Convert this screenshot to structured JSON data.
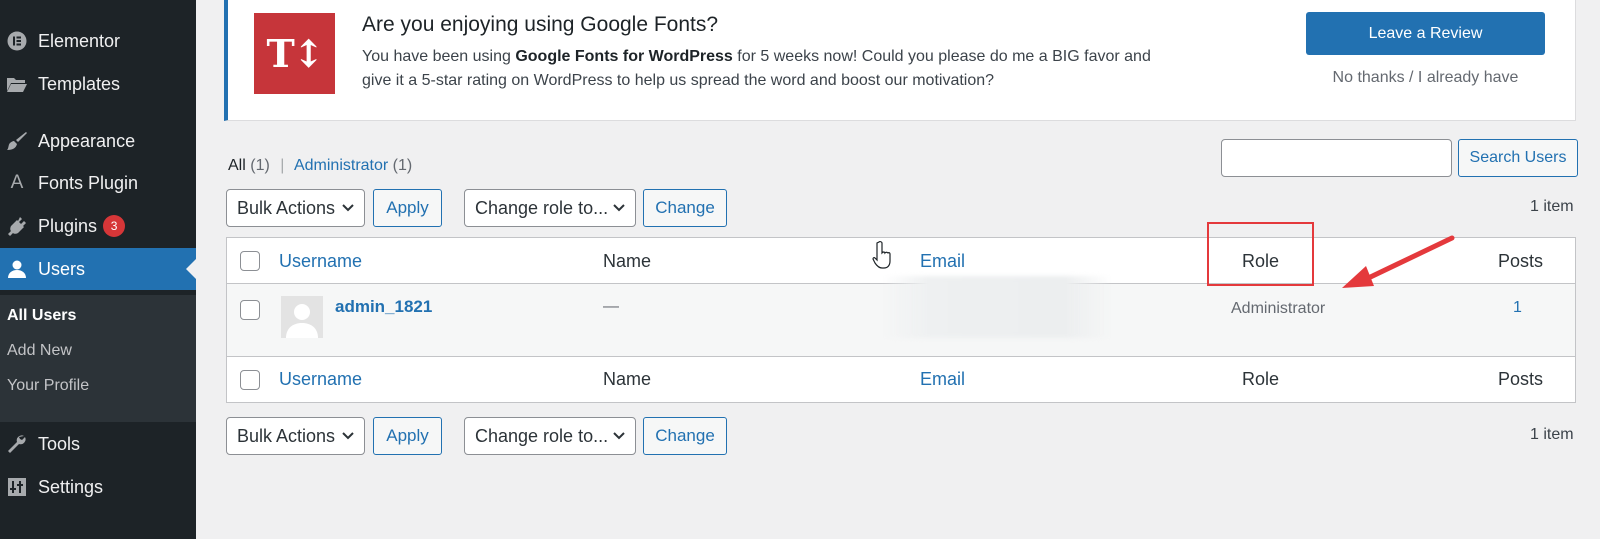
{
  "sidebar": {
    "items": [
      {
        "label": "Elementor",
        "icon": "elementor-icon"
      },
      {
        "label": "Templates",
        "icon": "folder-icon"
      },
      {
        "label": "Appearance",
        "icon": "paintbrush-icon"
      },
      {
        "label": "Fonts Plugin",
        "icon": "font-a-icon"
      },
      {
        "label": "Plugins",
        "icon": "plugin-icon",
        "badge": "3"
      },
      {
        "label": "Users",
        "icon": "user-icon",
        "active": true
      },
      {
        "label": "Tools",
        "icon": "wrench-icon"
      },
      {
        "label": "Settings",
        "icon": "settings-icon"
      }
    ],
    "submenu": [
      "All Users",
      "Add New",
      "Your Profile"
    ]
  },
  "notice": {
    "title": "Are you enjoying using Google Fonts?",
    "text_before": "You have been using ",
    "text_bold": "Google Fonts for WordPress",
    "text_after": " for 5 weeks now! Could you please do me a BIG favor and give it a 5-star rating on WordPress to help us spread the word and boost our motivation?",
    "review_button": "Leave a Review",
    "dismiss_link": "No thanks / I already have",
    "logo_text": "T↕"
  },
  "filters": {
    "all_label": "All",
    "all_count": "(1)",
    "admin_label": "Administrator",
    "admin_count": "(1)",
    "search_button": "Search Users",
    "search_value": ""
  },
  "tablenav": {
    "bulk_actions": "Bulk Actions",
    "apply": "Apply",
    "change_role": "Change role to...",
    "change": "Change",
    "items_count": "1 item"
  },
  "table": {
    "columns": [
      "Username",
      "Name",
      "Email",
      "Role",
      "Posts"
    ],
    "rows": [
      {
        "username": "admin_1821",
        "name": "—",
        "email": "",
        "role": "Administrator",
        "posts": "1"
      }
    ]
  },
  "colors": {
    "sidebar_bg": "#1d2327",
    "accent": "#2271b1",
    "highlight": "#e4393c",
    "logo_bg": "#c6353a"
  }
}
